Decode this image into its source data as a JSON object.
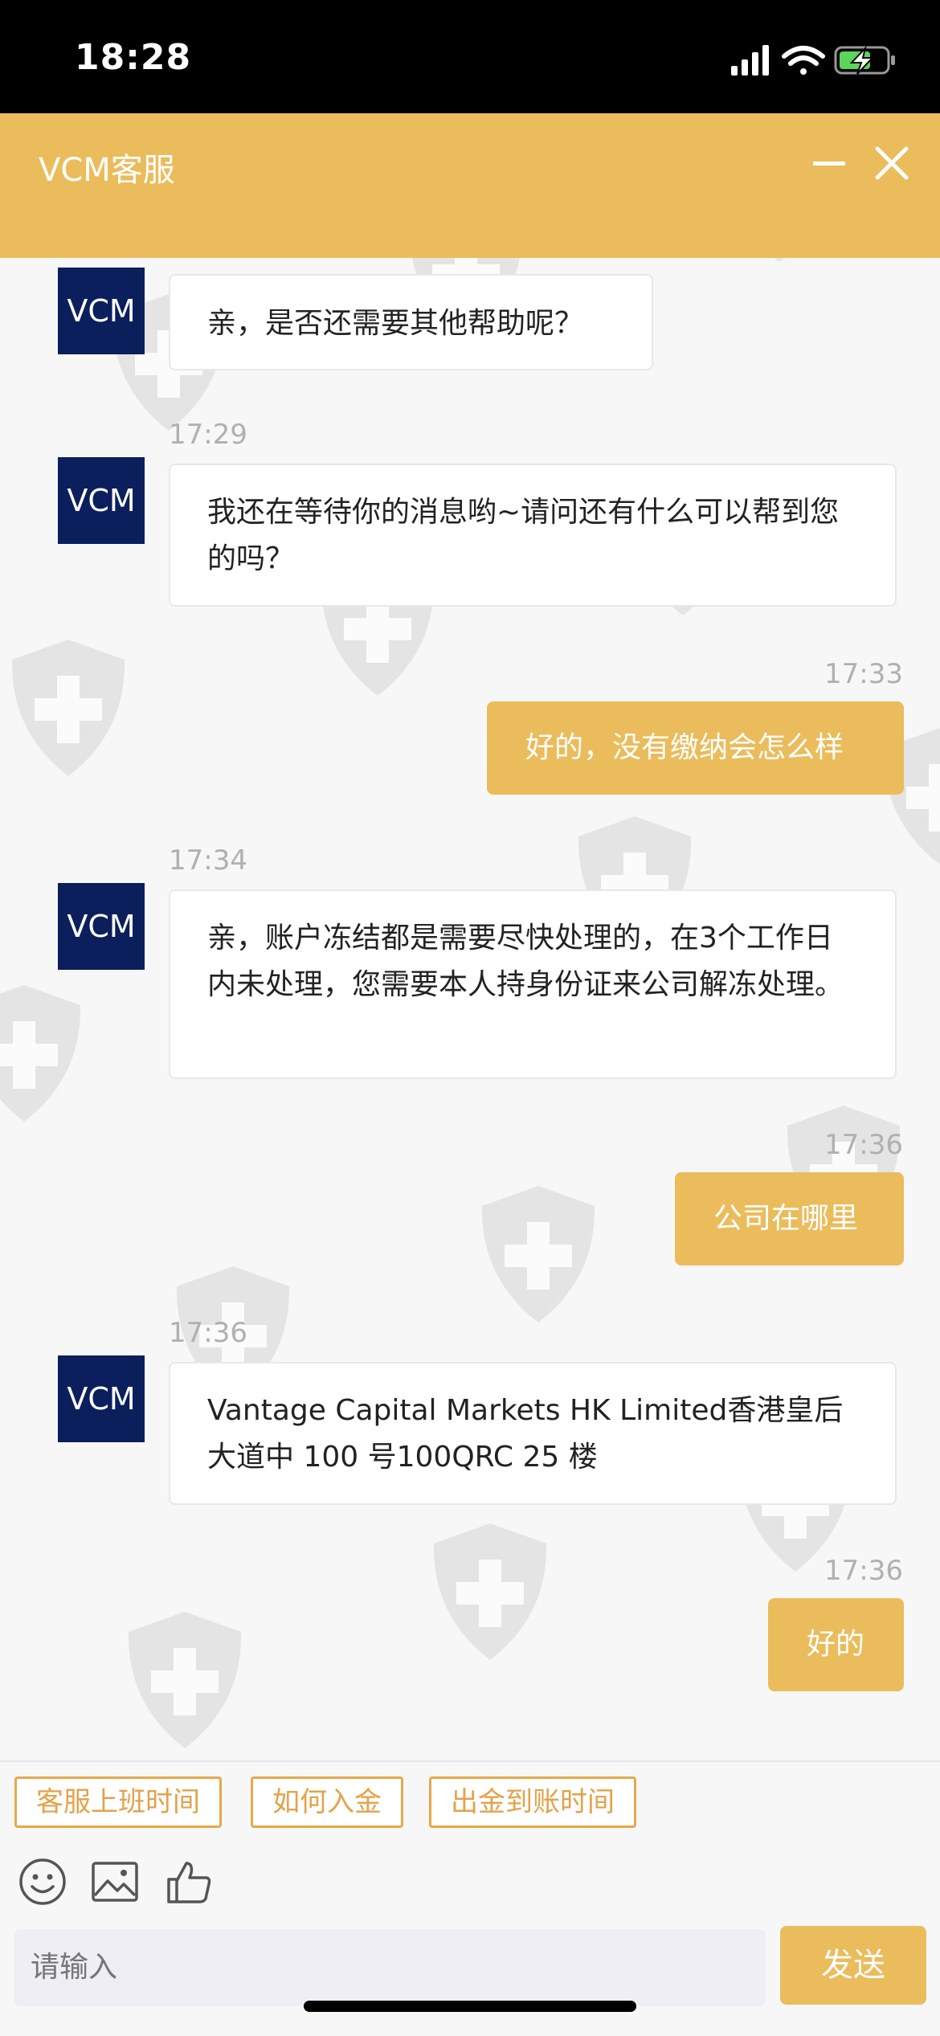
{
  "status_bar": {
    "time": "18:28"
  },
  "header": {
    "title": "VCM客服"
  },
  "messages": [
    {
      "side": "in",
      "avatar": "VCM",
      "text": "亲，是否还需要其他帮助呢？"
    },
    {
      "side": "in",
      "time": "17:29",
      "avatar": "VCM",
      "text": "我还在等待你的消息哟~请问还有什么可以帮到您的吗？"
    },
    {
      "side": "out",
      "time": "17:33",
      "text": "好的，没有缴纳会怎么样"
    },
    {
      "side": "in",
      "time": "17:34",
      "avatar": "VCM",
      "text": "亲，账户冻结都是需要尽快处理的，在3个工作日内未处理，您需要本人持身份证来公司解冻处理。"
    },
    {
      "side": "out",
      "time": "17:36",
      "text": "公司在哪里"
    },
    {
      "side": "in",
      "time": "17:36",
      "avatar": "VCM",
      "text": "Vantage Capital Markets HK Limited香港皇后大道中 100 号100QRC 25 楼"
    },
    {
      "side": "out",
      "time": "17:36",
      "text": "好的"
    }
  ],
  "quick_replies": [
    "客服上班时间",
    "如何入金",
    "出金到账时间"
  ],
  "toolbar_icons": [
    "emoji-icon",
    "image-icon",
    "thumbs-up-icon"
  ],
  "input": {
    "placeholder": "请输入"
  },
  "send_label": "发送",
  "colors": {
    "accent": "#ebbc5c",
    "avatar_bg": "#0b1f5c"
  }
}
